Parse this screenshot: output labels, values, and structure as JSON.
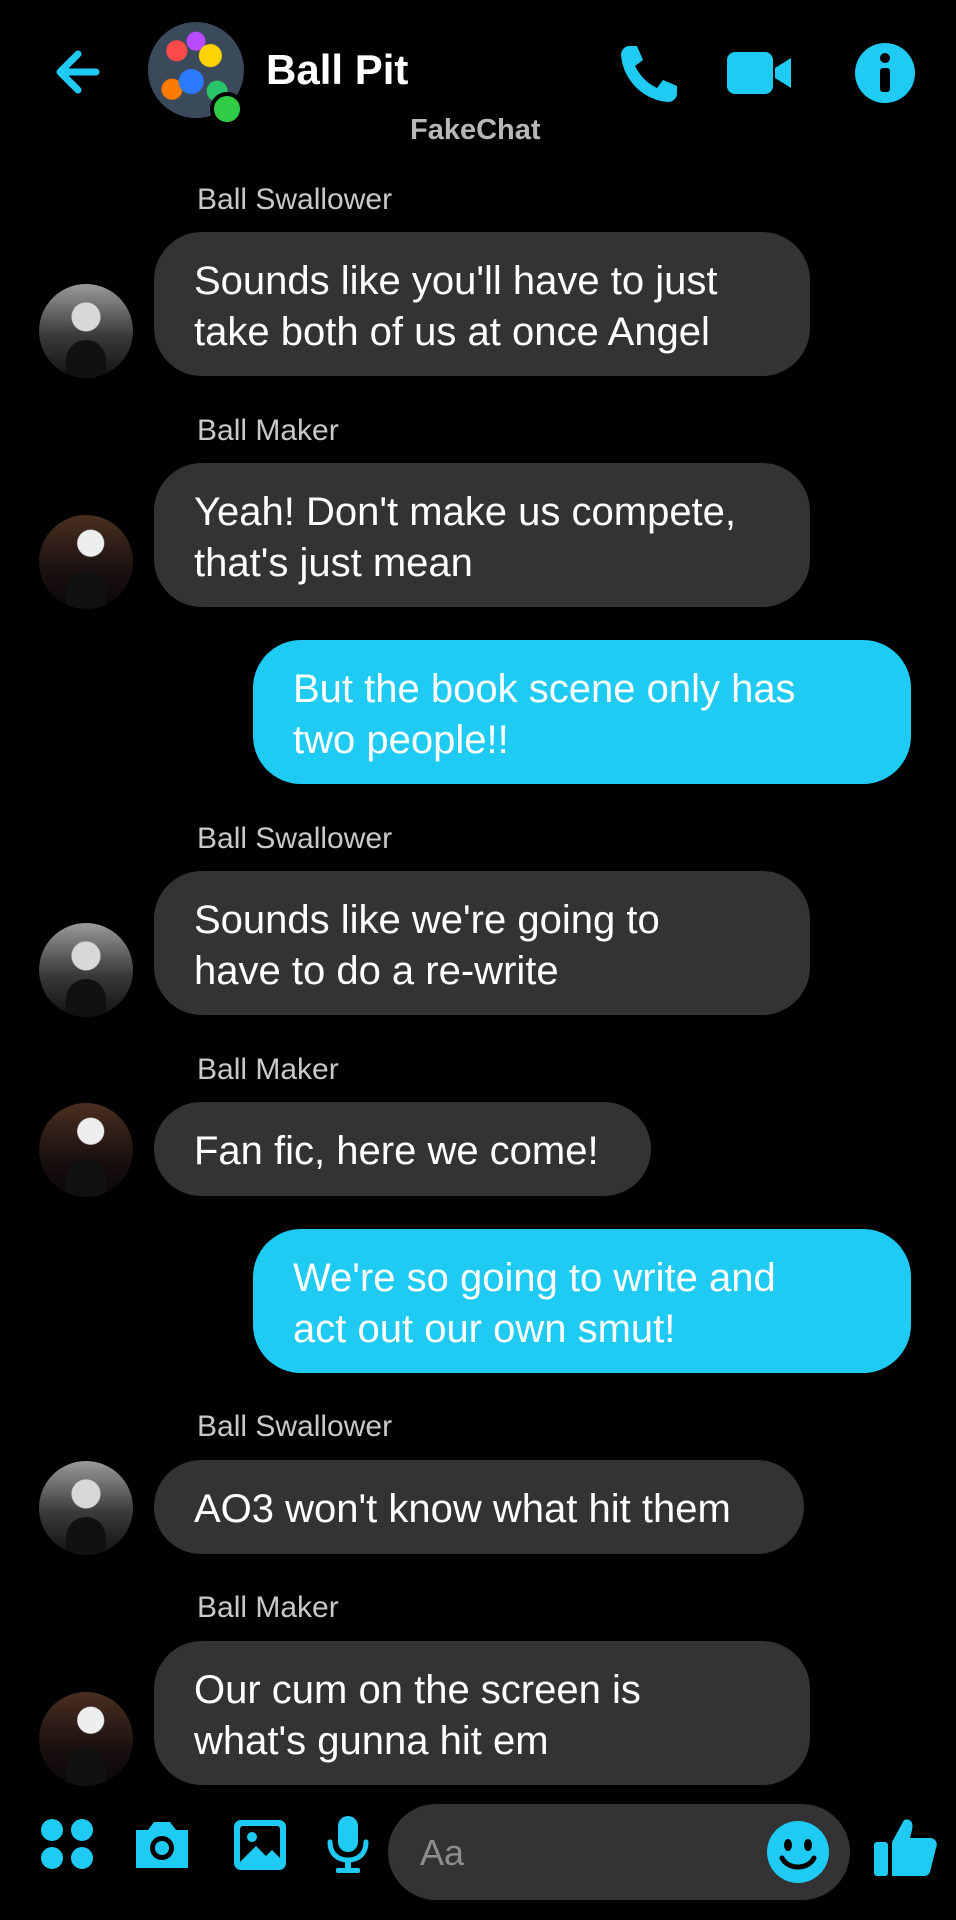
{
  "header": {
    "title": "Ball Pit",
    "subtitle": "FakeChat",
    "status": "online"
  },
  "messages": [
    {
      "sender": "Ball Swallower",
      "side": "received",
      "text": "Sounds like you'll have to just\ntake both of us at once Angel"
    },
    {
      "sender": "Ball Maker",
      "side": "received",
      "text": "Yeah!  Don't make us compete,\nthat's just mean"
    },
    {
      "sender": "",
      "side": "sent",
      "text": "But the book scene only has\ntwo people!!"
    },
    {
      "sender": "Ball Swallower",
      "side": "received",
      "text": "Sounds like we're going to\nhave to do a re-write"
    },
    {
      "sender": "Ball Maker",
      "side": "received",
      "text": "Fan fic, here we come!"
    },
    {
      "sender": "",
      "side": "sent",
      "text": "We're so going to write and\nact out our own smut!"
    },
    {
      "sender": "Ball Swallower",
      "side": "received",
      "text": "AO3 won't know what hit them"
    },
    {
      "sender": "Ball Maker",
      "side": "received",
      "text": "Our cum on the screen is\nwhat's gunna hit em"
    }
  ],
  "composer": {
    "placeholder": "Aa"
  },
  "colors": {
    "accent": "#1fcbf2",
    "received_bubble": "#333335",
    "background": "#000000",
    "online": "#31cc46"
  },
  "icons": [
    "back-arrow-icon",
    "phone-icon",
    "video-camera-icon",
    "info-icon",
    "apps-grid-icon",
    "camera-icon",
    "image-icon",
    "microphone-icon",
    "emoji-icon",
    "thumbs-up-icon"
  ]
}
